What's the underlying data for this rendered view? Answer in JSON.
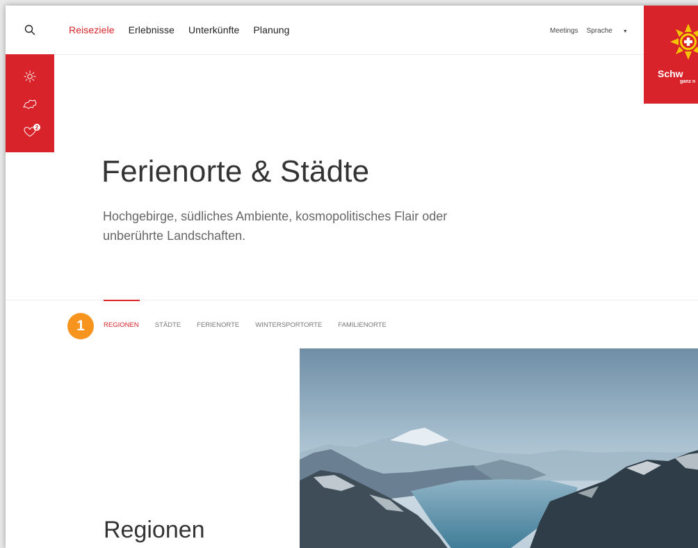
{
  "header": {
    "nav_items": [
      {
        "label": "Reiseziele",
        "active": true
      },
      {
        "label": "Erlebnisse",
        "active": false
      },
      {
        "label": "Unterkünfte",
        "active": false
      },
      {
        "label": "Planung",
        "active": false
      }
    ],
    "meetings_label": "Meetings",
    "language_label": "Sprache",
    "logo_text": "Schw",
    "logo_subtext": "ganz n"
  },
  "side_tools": {
    "items": [
      "sun-icon",
      "switzerland-map-icon",
      "heart-icon"
    ],
    "favorites_count": "2"
  },
  "hero": {
    "title": "Ferienorte & Städte",
    "subtitle": "Hochgebirge, südliches Ambiente, kosmopolitisches Flair oder unberührte Landschaften."
  },
  "tabs": [
    {
      "label": "Regionen",
      "active": true
    },
    {
      "label": "Städte",
      "active": false
    },
    {
      "label": "Ferienorte",
      "active": false
    },
    {
      "label": "Wintersportorte",
      "active": false
    },
    {
      "label": "Familienorte",
      "active": false
    }
  ],
  "annotation_marker": "1",
  "section": {
    "title": "Regionen"
  },
  "colors": {
    "accent": "#d8232a",
    "marker": "#f7941d"
  }
}
